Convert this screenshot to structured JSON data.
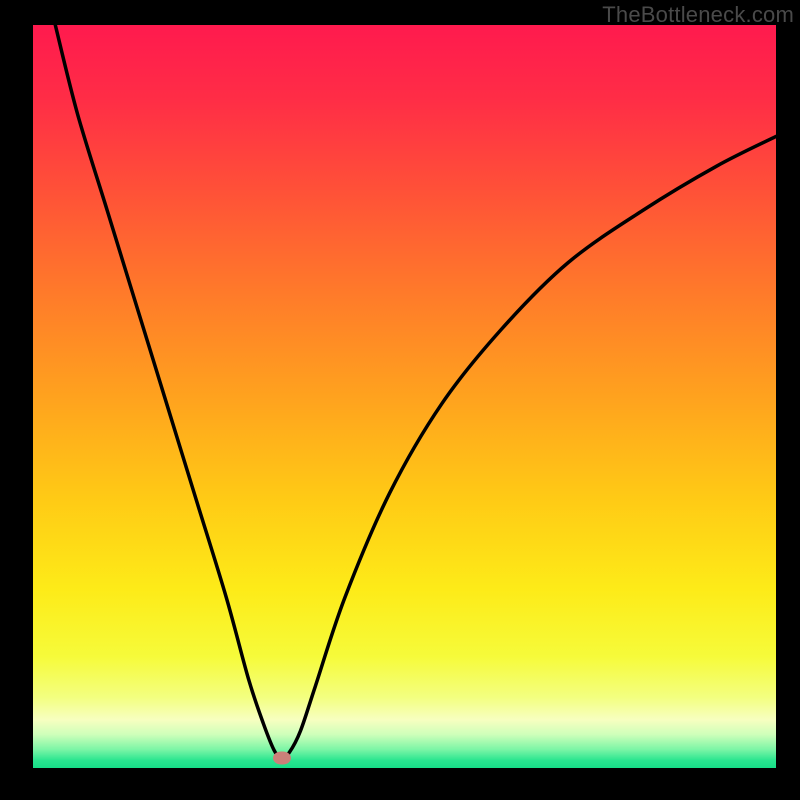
{
  "watermark": "TheBottleneck.com",
  "colors": {
    "frame": "#000000",
    "marker": "#cb8079",
    "curve": "#000000",
    "gradient_stops": [
      {
        "offset": 0.0,
        "color": "#ff1a4e"
      },
      {
        "offset": 0.1,
        "color": "#ff2d46"
      },
      {
        "offset": 0.22,
        "color": "#ff5038"
      },
      {
        "offset": 0.36,
        "color": "#ff7a2a"
      },
      {
        "offset": 0.5,
        "color": "#ffa21e"
      },
      {
        "offset": 0.64,
        "color": "#ffcb15"
      },
      {
        "offset": 0.76,
        "color": "#fdeb18"
      },
      {
        "offset": 0.85,
        "color": "#f6fb3a"
      },
      {
        "offset": 0.905,
        "color": "#f3ff80"
      },
      {
        "offset": 0.935,
        "color": "#f7ffc0"
      },
      {
        "offset": 0.955,
        "color": "#ceffba"
      },
      {
        "offset": 0.975,
        "color": "#7cf5a6"
      },
      {
        "offset": 0.99,
        "color": "#28e58f"
      },
      {
        "offset": 1.0,
        "color": "#17de88"
      }
    ]
  },
  "chart_data": {
    "type": "line",
    "title": "",
    "xlabel": "",
    "ylabel": "",
    "xlim": [
      0,
      100
    ],
    "ylim": [
      0,
      100
    ],
    "grid": false,
    "series": [
      {
        "name": "bottleneck-curve",
        "x": [
          3,
          6,
          10,
          14,
          18,
          22,
          26,
          29,
          31,
          32.5,
          33.5,
          34.5,
          36,
          38,
          42,
          48,
          55,
          63,
          72,
          82,
          92,
          100
        ],
        "y": [
          100,
          88,
          75,
          62,
          49,
          36,
          23,
          12,
          6,
          2.3,
          1.4,
          2.1,
          5,
          11,
          23,
          37,
          49,
          59,
          68,
          75,
          81,
          85
        ]
      }
    ],
    "annotations": [
      {
        "name": "optimal-marker",
        "x": 33.5,
        "y": 1.4
      }
    ],
    "gradient_value_range": {
      "top": 100,
      "bottom": 0
    }
  }
}
